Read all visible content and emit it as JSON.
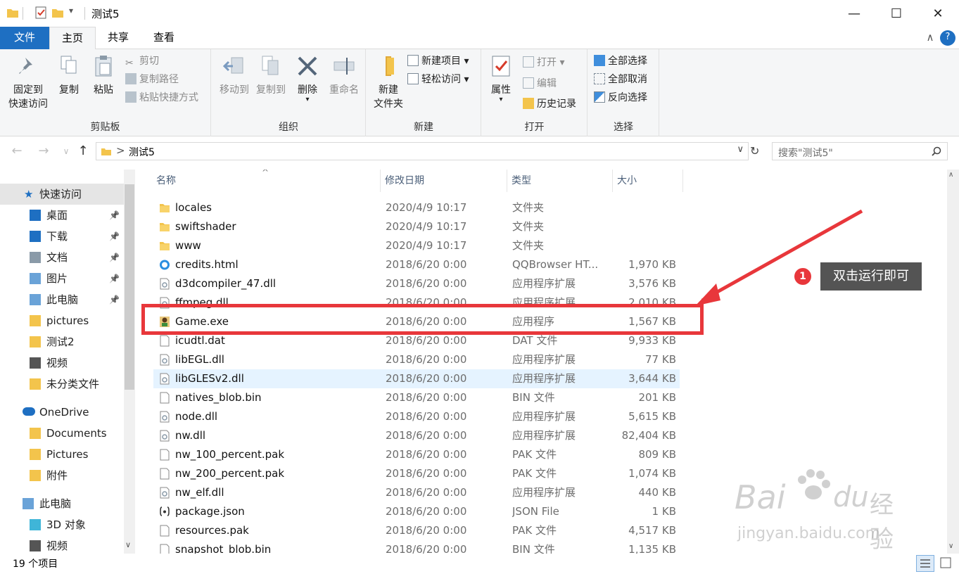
{
  "window": {
    "title": "测试5",
    "minimize_glyph": "—",
    "maximize_glyph": "☐",
    "close_glyph": "✕"
  },
  "ribbon_tabs": {
    "file": "文件",
    "home": "主页",
    "share": "共享",
    "view": "查看",
    "collapse_glyph": "∧",
    "help_glyph": "?"
  },
  "ribbon": {
    "clipboard": {
      "pin_label_1": "固定到",
      "pin_label_2": "快速访问",
      "copy": "复制",
      "paste": "粘贴",
      "cut": "剪切",
      "copy_path": "复制路径",
      "paste_shortcut": "粘贴快捷方式",
      "group_label": "剪贴板"
    },
    "organize": {
      "move_to": "移动到",
      "copy_to": "复制到",
      "delete": "删除",
      "rename": "重命名",
      "group_label": "组织"
    },
    "new": {
      "new_folder_1": "新建",
      "new_folder_2": "文件夹",
      "new_item": "新建项目",
      "easy_access": "轻松访问",
      "group_label": "新建"
    },
    "open": {
      "properties": "属性",
      "open": "打开",
      "edit": "编辑",
      "history": "历史记录",
      "group_label": "打开"
    },
    "select": {
      "select_all": "全部选择",
      "select_none": "全部取消",
      "invert": "反向选择",
      "group_label": "选择"
    }
  },
  "address": {
    "path_segment": "测试5",
    "separator": ">",
    "search_placeholder": "搜索\"测试5\""
  },
  "nav_pane": {
    "quick_access": "快速访问",
    "items": [
      {
        "label": "桌面",
        "icon": "desktop-icon",
        "pinned": true
      },
      {
        "label": "下载",
        "icon": "download-icon",
        "pinned": true
      },
      {
        "label": "文档",
        "icon": "documents-icon",
        "pinned": true
      },
      {
        "label": "图片",
        "icon": "pictures-icon",
        "pinned": true
      },
      {
        "label": "此电脑",
        "icon": "computer-icon",
        "pinned": true
      },
      {
        "label": "pictures",
        "icon": "folder-icon",
        "pinned": false
      },
      {
        "label": "测试2",
        "icon": "folder-icon",
        "pinned": false
      },
      {
        "label": "视频",
        "icon": "video-icon",
        "pinned": false
      },
      {
        "label": "未分类文件",
        "icon": "folder-icon",
        "pinned": false
      }
    ],
    "onedrive": "OneDrive",
    "onedrive_items": [
      "Documents",
      "Pictures",
      "附件"
    ],
    "this_pc": "此电脑",
    "this_pc_items": [
      "3D 对象",
      "视频"
    ]
  },
  "columns": {
    "name": "名称",
    "date": "修改日期",
    "type": "类型",
    "size": "大小"
  },
  "files": [
    {
      "name": "locales",
      "date": "2020/4/9 10:17",
      "type": "文件夹",
      "size": "",
      "icon": "folder"
    },
    {
      "name": "swiftshader",
      "date": "2020/4/9 10:17",
      "type": "文件夹",
      "size": "",
      "icon": "folder"
    },
    {
      "name": "www",
      "date": "2020/4/9 10:17",
      "type": "文件夹",
      "size": "",
      "icon": "folder"
    },
    {
      "name": "credits.html",
      "date": "2018/6/20 0:00",
      "type": "QQBrowser HT...",
      "size": "1,970 KB",
      "icon": "html"
    },
    {
      "name": "d3dcompiler_47.dll",
      "date": "2018/6/20 0:00",
      "type": "应用程序扩展",
      "size": "3,576 KB",
      "icon": "dll"
    },
    {
      "name": "ffmpeg.dll",
      "date": "2018/6/20 0:00",
      "type": "应用程序扩展",
      "size": "2,010 KB",
      "icon": "dll"
    },
    {
      "name": "Game.exe",
      "date": "2018/6/20 0:00",
      "type": "应用程序",
      "size": "1,567 KB",
      "icon": "exe"
    },
    {
      "name": "icudtl.dat",
      "date": "2018/6/20 0:00",
      "type": "DAT 文件",
      "size": "9,933 KB",
      "icon": "file"
    },
    {
      "name": "libEGL.dll",
      "date": "2018/6/20 0:00",
      "type": "应用程序扩展",
      "size": "77 KB",
      "icon": "dll"
    },
    {
      "name": "libGLESv2.dll",
      "date": "2018/6/20 0:00",
      "type": "应用程序扩展",
      "size": "3,644 KB",
      "icon": "dll"
    },
    {
      "name": "natives_blob.bin",
      "date": "2018/6/20 0:00",
      "type": "BIN 文件",
      "size": "201 KB",
      "icon": "file"
    },
    {
      "name": "node.dll",
      "date": "2018/6/20 0:00",
      "type": "应用程序扩展",
      "size": "5,615 KB",
      "icon": "dll"
    },
    {
      "name": "nw.dll",
      "date": "2018/6/20 0:00",
      "type": "应用程序扩展",
      "size": "82,404 KB",
      "icon": "dll"
    },
    {
      "name": "nw_100_percent.pak",
      "date": "2018/6/20 0:00",
      "type": "PAK 文件",
      "size": "809 KB",
      "icon": "file"
    },
    {
      "name": "nw_200_percent.pak",
      "date": "2018/6/20 0:00",
      "type": "PAK 文件",
      "size": "1,074 KB",
      "icon": "file"
    },
    {
      "name": "nw_elf.dll",
      "date": "2018/6/20 0:00",
      "type": "应用程序扩展",
      "size": "440 KB",
      "icon": "dll"
    },
    {
      "name": "package.json",
      "date": "2018/6/20 0:00",
      "type": "JSON File",
      "size": "1 KB",
      "icon": "json"
    },
    {
      "name": "resources.pak",
      "date": "2018/6/20 0:00",
      "type": "PAK 文件",
      "size": "4,517 KB",
      "icon": "file"
    },
    {
      "name": "snapshot_blob.bin",
      "date": "2018/6/20 0:00",
      "type": "BIN 文件",
      "size": "1,135 KB",
      "icon": "file"
    }
  ],
  "status": {
    "item_count": "19 个项目"
  },
  "annotation": {
    "step_number": "1",
    "callout_text": "双击运行即可",
    "highlight_color": "#e8373b"
  },
  "watermark": {
    "brand": "Bai",
    "brand_suffix": "du",
    "cn": "经验",
    "url": "jingyan.baidu.com"
  },
  "colors": {
    "accent": "#1e6fc2",
    "selection": "#e5f3ff",
    "folder": "#f3c44c"
  }
}
